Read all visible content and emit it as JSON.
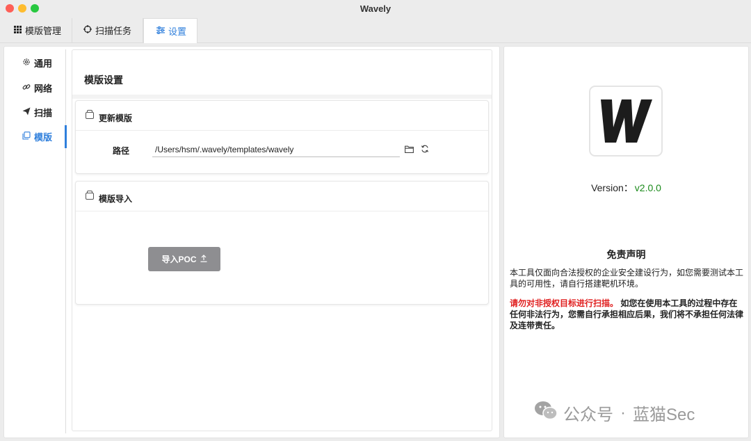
{
  "window": {
    "title": "Wavely"
  },
  "tabs": [
    {
      "label": "模版管理",
      "icon": "grid-icon"
    },
    {
      "label": "扫描任务",
      "icon": "crosshair-icon"
    },
    {
      "label": "设置",
      "icon": "sliders-icon",
      "active": true
    }
  ],
  "sidebar": {
    "items": [
      {
        "label": "通用",
        "icon": "gear-icon"
      },
      {
        "label": "网络",
        "icon": "link-icon"
      },
      {
        "label": "扫描",
        "icon": "paper-plane-icon"
      },
      {
        "label": "模版",
        "icon": "copy-icon",
        "active": true
      }
    ]
  },
  "main": {
    "section_title": "模版设置",
    "update_card": {
      "title": "更新模版",
      "path_label": "路径",
      "path_value": "/Users/hsm/.wavely/templates/wavely"
    },
    "import_card": {
      "title": "模版导入",
      "button_label": "导入POC"
    }
  },
  "about": {
    "logo_letter": "W",
    "version_label": "Version：",
    "version_value": "v2.0.0",
    "disclaimer_title": "免责声明",
    "disclaimer_text": "本工具仅面向合法授权的企业安全建设行为，如您需要测试本工具的可用性，请自行搭建靶机环境。",
    "warning_red": "请勿对非授权目标进行扫描。",
    "warning_text": "如您在使用本工具的过程中存在任何非法行为，您需自行承担相应后果，我们将不承担任何法律及连带责任。"
  },
  "watermark": {
    "prefix": "公众号",
    "separator": "·",
    "name": "蓝猫Sec"
  },
  "colors": {
    "accent": "#2f7fdc",
    "version": "#1a8a1a",
    "warning": "#e02020",
    "button": "#8e8e91"
  }
}
